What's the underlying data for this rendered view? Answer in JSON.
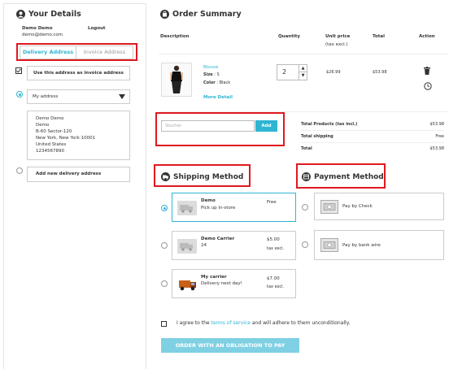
{
  "details": {
    "title": "Your Details",
    "user_name": "Demo Demo",
    "email": "demo@demo.com",
    "logout": "Logout",
    "tab_delivery": "Delivery Address",
    "tab_invoice": "Invoice Address",
    "use_invoice_label": "Use this address as invoice address",
    "address_select": "My address",
    "address_lines": [
      "Demo Demo",
      "Demo",
      "B-60 Sector-120",
      "New York, New York 10001",
      "United States",
      "1234567890"
    ],
    "add_new": "Add new delivery address"
  },
  "summary": {
    "title": "Order Summary",
    "col_description": "Description",
    "col_quantity": "Quantity",
    "col_unit_price": "Unit price",
    "col_unit_price_sub": "(tax excl.)",
    "col_total": "Total",
    "col_action": "Action",
    "product": {
      "name": "Blouse",
      "size_label": "Size",
      "size_value": ": S",
      "color_label": "Color",
      "color_value": ": Black",
      "more": "More Detail",
      "qty": "2",
      "unit_price": "$26.99",
      "total": "$53.98"
    },
    "voucher_placeholder": "Voucher",
    "voucher_button": "Add",
    "totals": [
      {
        "label": "Total Products (tax incl.)",
        "value": "$53.98"
      },
      {
        "label": "Total shipping",
        "value": "Free"
      },
      {
        "label": "Total",
        "value": "$53.98"
      }
    ]
  },
  "shipping": {
    "title": "Shipping Method",
    "options": [
      {
        "name": "Demo",
        "desc": "Pick up in-store",
        "price": "Free",
        "tax": ""
      },
      {
        "name": "Demo Carrier",
        "desc": "24",
        "price": "$5.00",
        "tax": "tax excl."
      },
      {
        "name": "My carrier",
        "desc": "Delivery next day!",
        "price": "$7.00",
        "tax": "tax excl."
      }
    ]
  },
  "payment": {
    "title": "Payment Method",
    "options": [
      {
        "label": "Pay by Check"
      },
      {
        "label": "Pay by bank wire"
      }
    ]
  },
  "terms": {
    "prefix": "I agree to the",
    "link": "terms of service",
    "suffix": "and will adhere to them unconditionally."
  },
  "order_button": "ORDER WITH AN OBLIGATION TO PAY",
  "colors": {
    "accent": "#2fb5d2",
    "highlight": "#e0181f"
  }
}
